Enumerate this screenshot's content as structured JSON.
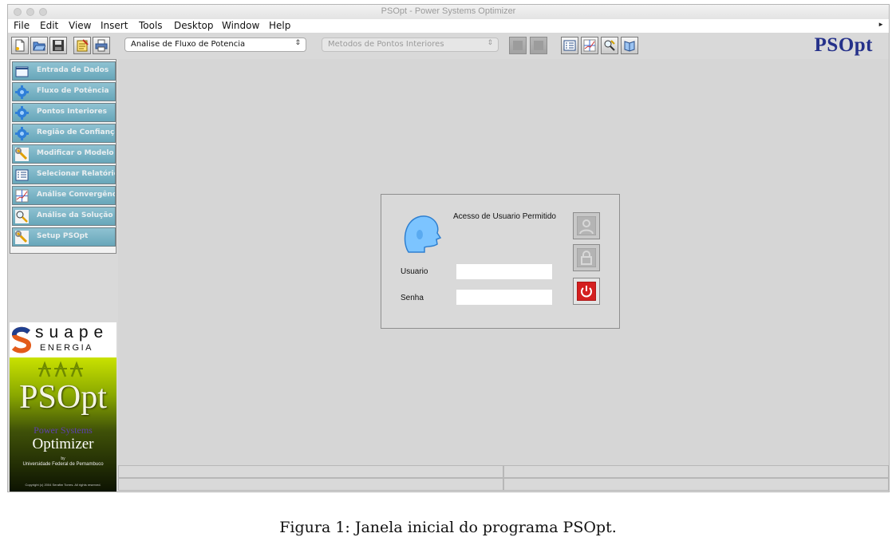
{
  "window": {
    "title": "PSOpt - Power Systems Optimizer"
  },
  "menu": [
    "File",
    "Edit",
    "View",
    "Insert",
    "Tools",
    "Desktop",
    "Window",
    "Help"
  ],
  "toolbar": {
    "analysis_select": "Analise de Fluxo de Potencia",
    "method_select": "Metodos de Pontos Interiores",
    "brand": "PSOpt"
  },
  "sidebar": {
    "items": [
      {
        "label": "Entrada de Dados",
        "icon": "folder-icon"
      },
      {
        "label": "Fluxo de Potência",
        "icon": "gear-icon"
      },
      {
        "label": "Pontos Interiores",
        "icon": "gear-icon"
      },
      {
        "label": "Região de Confiança",
        "icon": "gear-icon"
      },
      {
        "label": "Modificar o Modelo",
        "icon": "wrench-icon"
      },
      {
        "label": "Selecionar Relatórios",
        "icon": "report-icon"
      },
      {
        "label": "Análise Convergência",
        "icon": "graph-icon"
      },
      {
        "label": "Análise da Solução",
        "icon": "magnifier-icon"
      },
      {
        "label": "Setup PSOpt",
        "icon": "wrench-icon"
      }
    ]
  },
  "login": {
    "title": "Acesso de Usuario Permitido",
    "user_label": "Usuario",
    "password_label": "Senha",
    "user_value": "",
    "password_value": ""
  },
  "logos": {
    "suape_top": "suape",
    "suape_sub": "ENERGIA",
    "splash_title": "PSOpt",
    "splash_sub1": "Power Systems",
    "splash_sub2": "Optimizer",
    "splash_by": "by",
    "splash_uni": "Universidade Federal de Pernambuco",
    "splash_copy": "Copyright (c) 2004 Serafim Torres. All rights reserved."
  },
  "caption": "Figura 1: Janela inicial do programa PSOpt.",
  "colors": {
    "brand": "#25318a",
    "sidebar_button": "#7ab3c5",
    "power_button": "#d42020"
  }
}
